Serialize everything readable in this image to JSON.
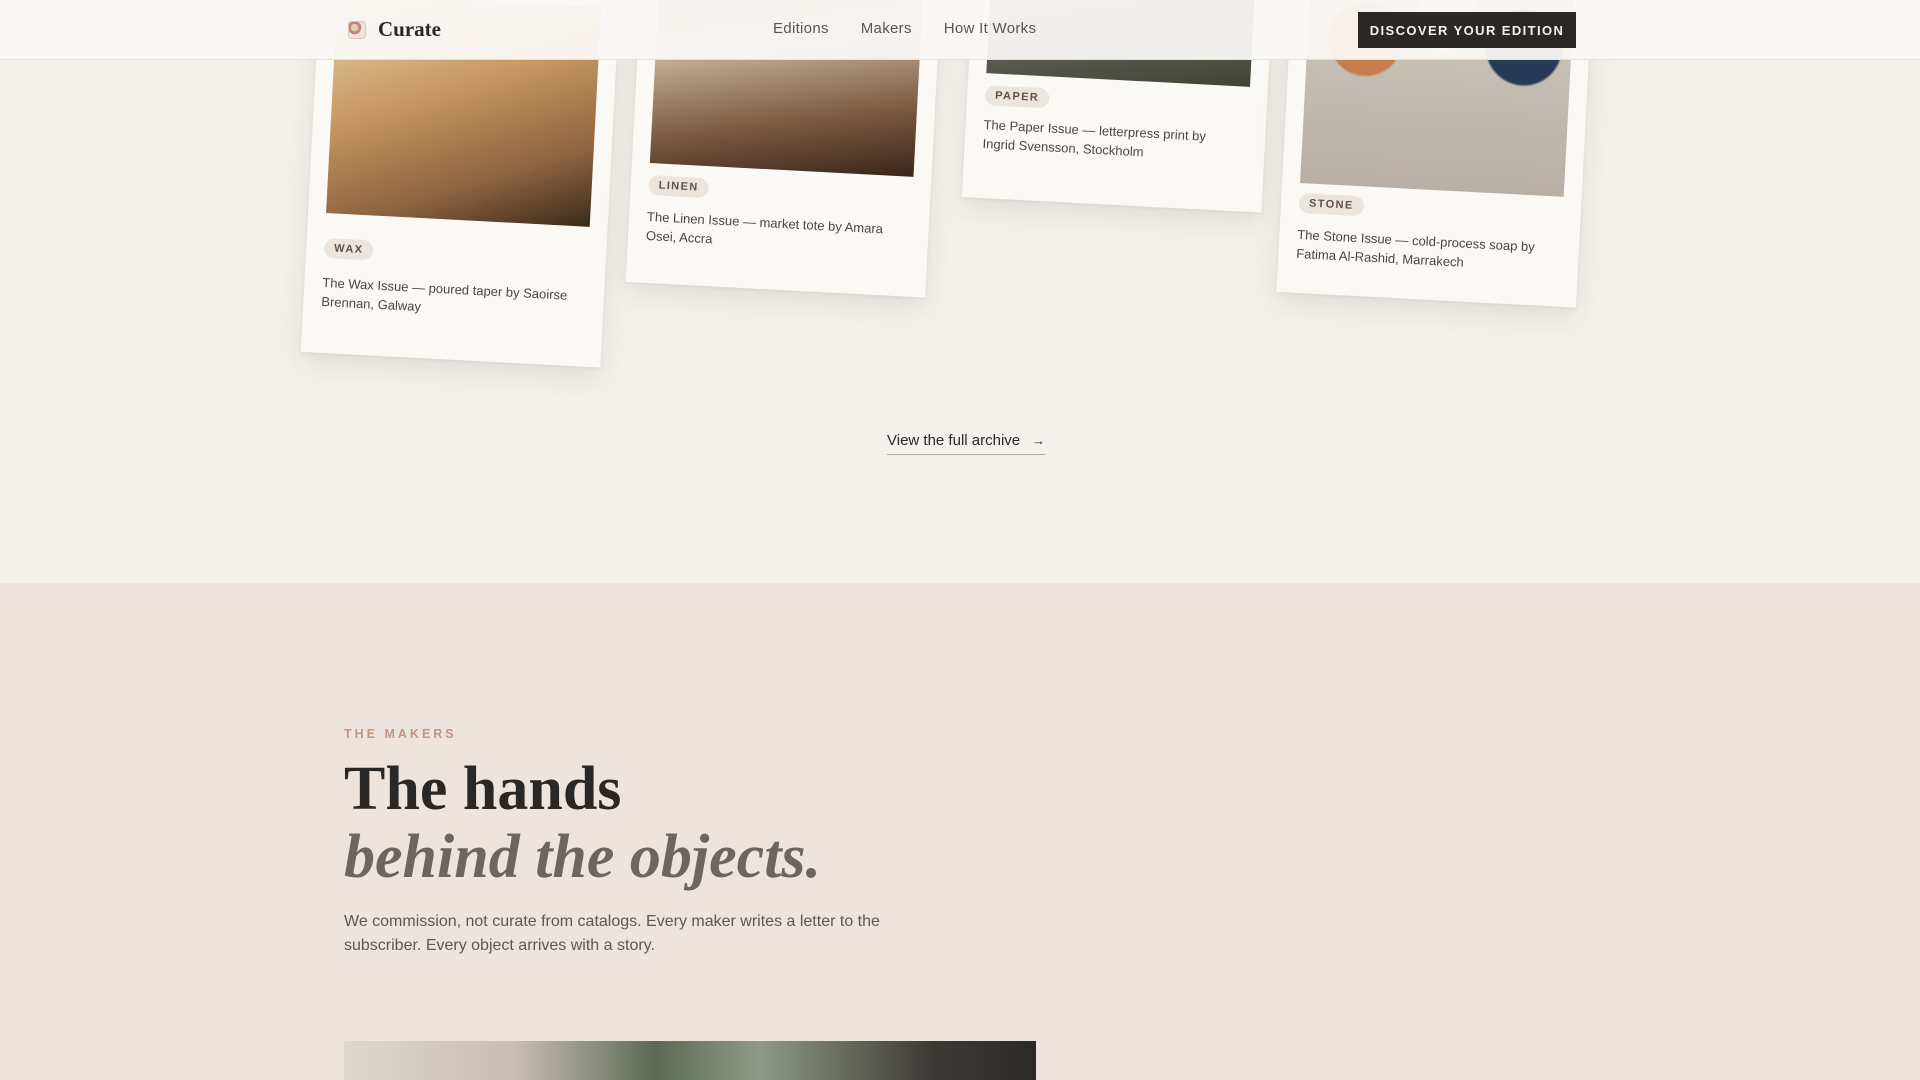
{
  "nav": {
    "brand": "Curate",
    "links": [
      "Editions",
      "Makers",
      "How It Works"
    ],
    "cta": "DISCOVER YOUR EDITION"
  },
  "editions": [
    {
      "tag": "WAX",
      "caption": "The Wax Issue — poured taper by Saoirse Brennan, Galway"
    },
    {
      "tag": "LINEN",
      "caption": "The Linen Issue — market tote by Amara Osei, Accra"
    },
    {
      "tag": "PAPER",
      "caption": "The Paper Issue — letterpress print by Ingrid Svensson, Stockholm"
    },
    {
      "tag": "STONE",
      "caption": "The Stone Issue — cold-process soap by Fatima Al-Rashid, Marrakech"
    }
  ],
  "archive": {
    "label": "View the full archive",
    "arrow": "→"
  },
  "makers": {
    "eyebrow": "THE MAKERS",
    "heading_line1": "The hands",
    "heading_line2": "behind the objects.",
    "body": "We commission, not curate from catalogs. Every maker writes a letter to the subscriber. Every object arrives with a story."
  },
  "colors": {
    "page_bg": "#f4f0eb",
    "section_bg": "#ede5dd",
    "accent": "#c09680",
    "cta_bg": "#2a2826"
  },
  "icons": {
    "logo": "curate-logo-icon",
    "arrow": "arrow-right-icon"
  }
}
